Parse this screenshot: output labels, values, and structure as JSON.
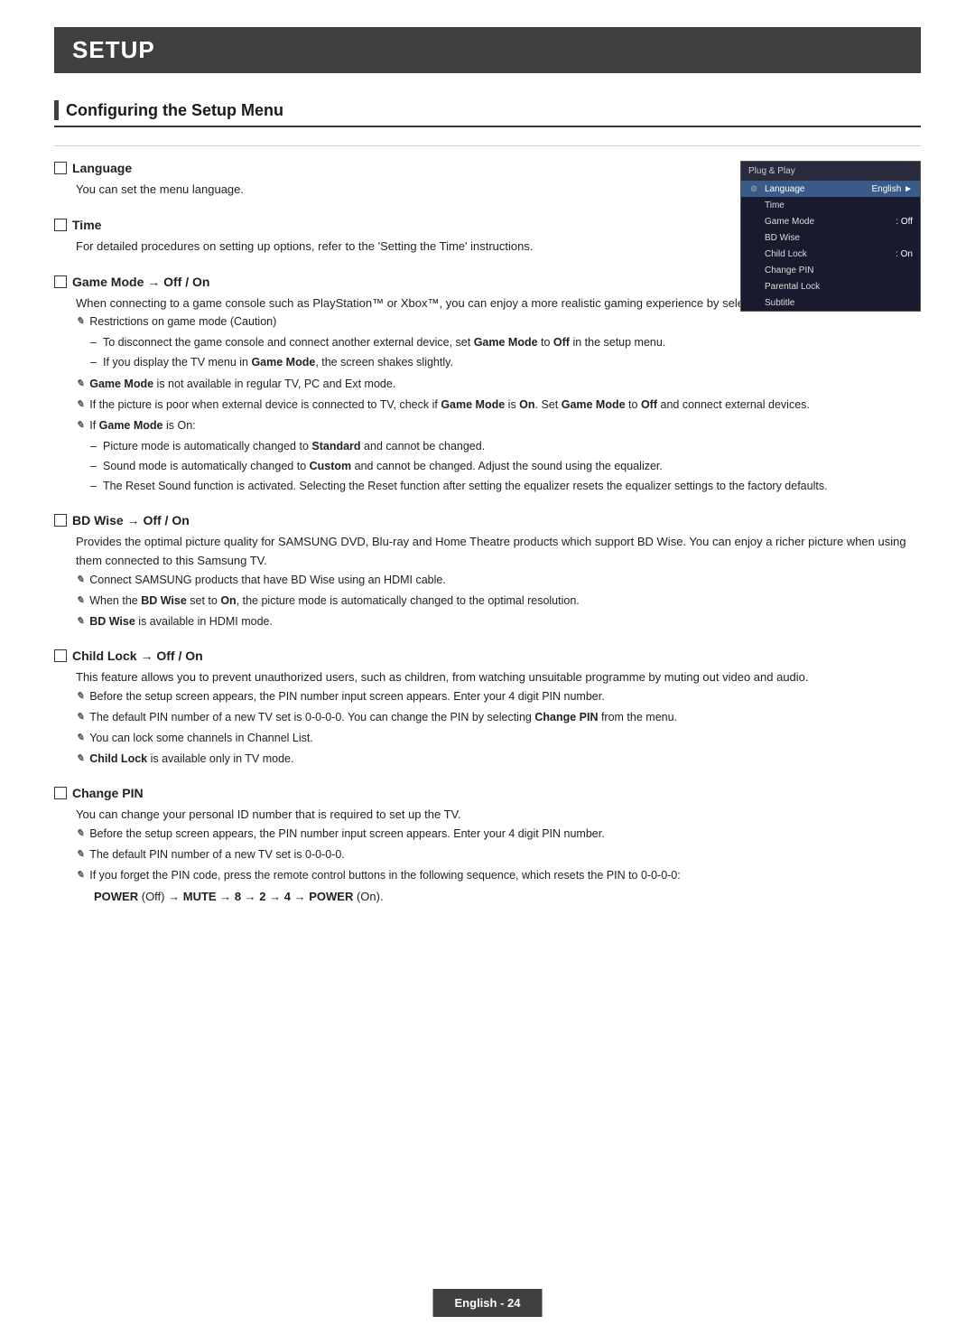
{
  "header": {
    "title": "SETUP"
  },
  "section": {
    "title": "Configuring the Setup Menu"
  },
  "tv_menu": {
    "header": "Plug & Play",
    "items": [
      {
        "icon": "settings",
        "label": "Language",
        "value": "English",
        "arrow": "►",
        "highlighted": true
      },
      {
        "icon": "",
        "label": "Time",
        "value": "",
        "highlighted": false
      },
      {
        "icon": "",
        "label": "Game Mode",
        "value": ": Off",
        "highlighted": false
      },
      {
        "icon": "",
        "label": "BD Wise",
        "value": "",
        "highlighted": false
      },
      {
        "icon": "",
        "label": "Child Lock",
        "value": ": On",
        "highlighted": false
      },
      {
        "icon": "",
        "label": "Change PIN",
        "value": "",
        "highlighted": false
      },
      {
        "icon": "",
        "label": "Parental Lock",
        "value": "",
        "highlighted": false
      },
      {
        "icon": "",
        "label": "Subtitle",
        "value": "",
        "highlighted": false
      }
    ]
  },
  "subsections": [
    {
      "id": "language",
      "title": "Language",
      "body": "You can set the menu language.",
      "notes": [],
      "bullets": []
    },
    {
      "id": "time",
      "title": "Time",
      "body": "For detailed procedures on setting up options, refer to the 'Setting the Time' instructions.",
      "notes": [],
      "bullets": []
    },
    {
      "id": "game-mode",
      "title": "Game Mode → Off / On",
      "body": "When connecting to a game console such as PlayStation™ or Xbox™, you can enjoy a more realistic gaming experience by selecting game menu.",
      "notes": [
        {
          "type": "note",
          "text": "Restrictions on game mode (Caution)",
          "sub_bullets": [
            "To disconnect the game console and connect another external device, set Game Mode to Off in the setup menu.",
            "If you display the TV menu in Game Mode, the screen shakes slightly."
          ]
        },
        {
          "type": "note",
          "text": "Game Mode is not available in regular TV, PC and Ext mode.",
          "sub_bullets": []
        },
        {
          "type": "note",
          "text": "If the picture is poor when external device is connected to TV, check if Game Mode is On. Set Game Mode to Off and connect external devices.",
          "sub_bullets": []
        },
        {
          "type": "note",
          "text": "If Game Mode is On:",
          "sub_bullets": [
            "Picture mode is automatically changed to Standard and cannot be changed.",
            "Sound mode is automatically changed to Custom and cannot be changed. Adjust the sound using the equalizer.",
            "The Reset Sound function is activated. Selecting the Reset function after setting the equalizer resets the equalizer settings to the factory defaults."
          ]
        }
      ]
    },
    {
      "id": "bd-wise",
      "title": "BD Wise → Off / On",
      "body": "Provides the optimal picture quality for SAMSUNG DVD, Blu-ray and Home Theatre products which support BD Wise. You can enjoy a richer picture when using them connected to this Samsung TV.",
      "notes": [
        {
          "type": "note",
          "text": "Connect SAMSUNG products that have BD Wise using an HDMI cable.",
          "sub_bullets": []
        },
        {
          "type": "note",
          "text": "When the BD Wise set to On, the picture mode is automatically changed to the optimal resolution.",
          "sub_bullets": []
        },
        {
          "type": "note",
          "text": "BD Wise is available in HDMI mode.",
          "sub_bullets": []
        }
      ]
    },
    {
      "id": "child-lock",
      "title": "Child Lock → Off / On",
      "body": "This feature allows you to prevent unauthorized users, such as children, from watching unsuitable programme by muting out video and audio.",
      "notes": [
        {
          "type": "note",
          "text": "Before the setup screen appears, the PIN number input screen appears. Enter your 4 digit PIN number.",
          "sub_bullets": []
        },
        {
          "type": "note",
          "text": "The default PIN number of a new TV set is 0-0-0-0. You can change the PIN by selecting Change PIN from the menu.",
          "sub_bullets": []
        },
        {
          "type": "note",
          "text": "You can lock some channels in Channel List.",
          "sub_bullets": []
        },
        {
          "type": "note",
          "text": "Child Lock is available only in TV mode.",
          "sub_bullets": []
        }
      ]
    },
    {
      "id": "change-pin",
      "title": "Change PIN",
      "body": "You can change your personal ID number that is required to set up the TV.",
      "notes": [
        {
          "type": "note",
          "text": "Before the setup screen appears, the PIN number input screen appears. Enter your 4 digit PIN number.",
          "sub_bullets": []
        },
        {
          "type": "note",
          "text": "The default PIN number of a new TV set is 0-0-0-0.",
          "sub_bullets": []
        },
        {
          "type": "note",
          "text": "If you forget the PIN code, press the remote control buttons in the following sequence, which resets the PIN to 0-0-0-0:",
          "sub_bullets": []
        }
      ],
      "power_sequence": "POWER (Off) → MUTE → 8 → 2 → 4 → POWER (On)."
    }
  ],
  "footer": {
    "label": "English - 24"
  }
}
